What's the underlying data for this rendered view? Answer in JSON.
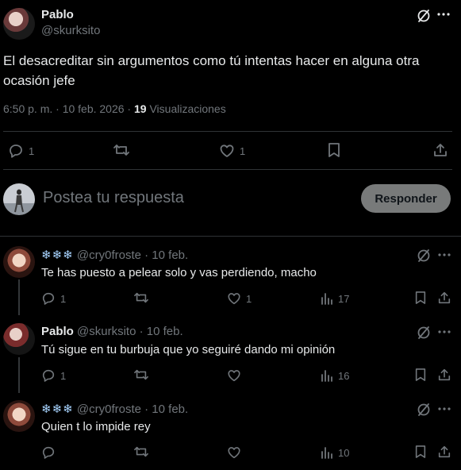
{
  "main_post": {
    "author_name": "Pablo",
    "handle": "@skurksito",
    "text_line1": "El desacreditar sin argumentos como tú intentas hacer en alguna otra",
    "text_line2": "ocasión jefe",
    "time": "6:50 p. m. · 10 feb. 2026 ·",
    "views_count": "19",
    "views_label": "Visualizaciones",
    "replies": "1",
    "likes": "1"
  },
  "composer": {
    "placeholder": "Postea tu respuesta",
    "reply_button": "Responder"
  },
  "replies": [
    {
      "name": "❄❄❄",
      "handle_date": "@cry0froste · 10 feb.",
      "text": "Te has puesto a pelear solo y vas perdiendo, macho",
      "replies": "1",
      "likes": "1",
      "views": "17"
    },
    {
      "name": "Pablo",
      "handle_date": "@skurksito · 10 feb.",
      "text": "Tú sigue en tu burbuja que yo seguiré dando mi opinión",
      "replies": "1",
      "likes": "",
      "views": "16"
    },
    {
      "name": "❄❄❄",
      "handle_date": "@cry0froste · 10 feb.",
      "text": "Quien t lo impide rey",
      "replies": "",
      "likes": "",
      "views": "10"
    }
  ],
  "icons": {
    "grok": "grok-icon",
    "more": "more-icon",
    "reply": "reply-icon",
    "repost": "repost-icon",
    "like": "heart-icon",
    "bookmark": "bookmark-icon",
    "share": "share-icon",
    "views": "views-icon"
  }
}
